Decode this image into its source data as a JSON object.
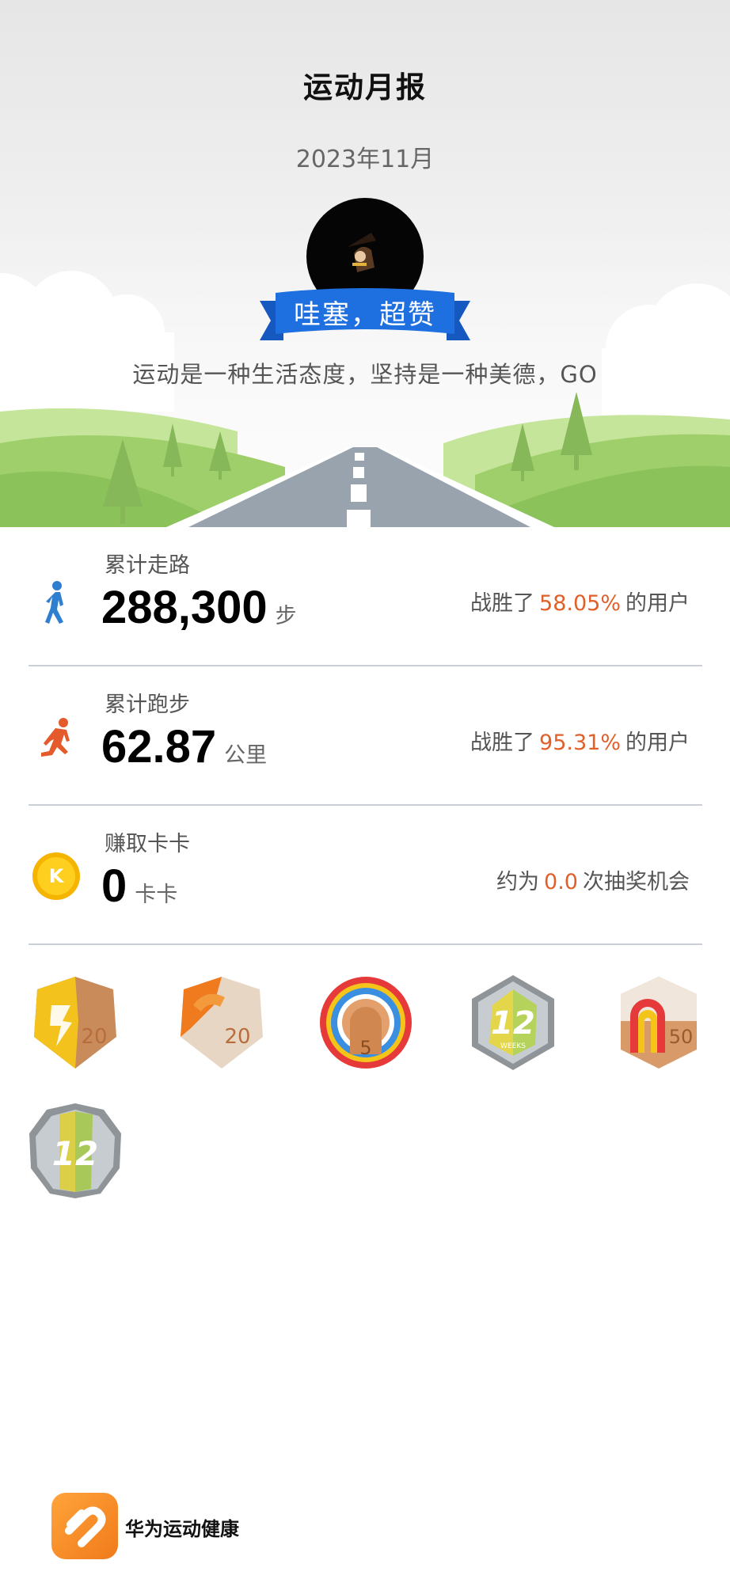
{
  "header": {
    "title": "运动月报",
    "date": "2023年11月",
    "badge_text": "哇塞，超赞",
    "motto": "运动是一种生活态度，坚持是一种美德，GO"
  },
  "stats": [
    {
      "label": "累计走路",
      "value": "288,300",
      "unit": "步",
      "beat_prefix": "战胜了",
      "beat_value": "58.05%",
      "beat_suffix": "的用户",
      "icon": "walking-icon"
    },
    {
      "label": "累计跑步",
      "value": "62.87",
      "unit": "公里",
      "beat_prefix": "战胜了",
      "beat_value": "95.31%",
      "beat_suffix": "的用户",
      "icon": "running-icon"
    },
    {
      "label": "赚取卡卡",
      "value": "0",
      "unit": "卡卡",
      "beat_prefix": "约为",
      "beat_value": "0.0",
      "beat_suffix": "次抽奖机会",
      "icon": "kaka-coin-icon",
      "coin_letter": "K"
    }
  ],
  "medals": [
    {
      "name": "medal-20-yellow",
      "number": "20"
    },
    {
      "name": "medal-20-orange",
      "number": "20"
    },
    {
      "name": "medal-5-rainbow",
      "number": "5"
    },
    {
      "name": "medal-12-weeks",
      "number": "12",
      "caption": "WEEKS"
    },
    {
      "name": "medal-50-rainbow",
      "number": "50"
    },
    {
      "name": "medal-12-round",
      "number": "12"
    }
  ],
  "footer": {
    "app_name": "华为运动健康",
    "logo_icon": "huawei-health-logo-icon"
  },
  "colors": {
    "accent": "#e0602a",
    "walk_icon": "#2f7fd0",
    "run_icon": "#e45a2c",
    "ribbon": "#1e6fe0",
    "divider": "#c9cfd4"
  }
}
